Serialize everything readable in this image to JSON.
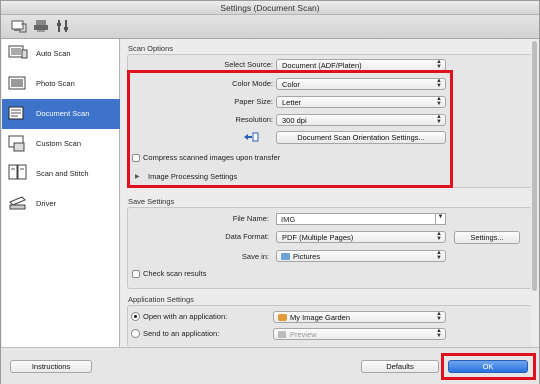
{
  "window": {
    "title": "Settings (Document Scan)"
  },
  "toolbar": {
    "icons": [
      "scan-from-computer-icon",
      "scan-from-panel-icon",
      "general-settings-icon"
    ]
  },
  "sidebar": {
    "items": [
      {
        "label": "Auto Scan",
        "icon": "auto-scan-icon",
        "active": false
      },
      {
        "label": "Photo Scan",
        "icon": "photo-scan-icon",
        "active": false
      },
      {
        "label": "Document Scan",
        "icon": "document-scan-icon",
        "active": true
      },
      {
        "label": "Custom Scan",
        "icon": "custom-scan-icon",
        "active": false
      },
      {
        "label": "Scan and Stitch",
        "icon": "scan-and-stitch-icon",
        "active": false
      },
      {
        "label": "Driver",
        "icon": "driver-icon",
        "active": false
      }
    ]
  },
  "scan_options": {
    "title": "Scan Options",
    "select_source_label": "Select Source:",
    "select_source_value": "Document (ADF/Platen)",
    "color_mode_label": "Color Mode:",
    "color_mode_value": "Color",
    "paper_size_label": "Paper Size:",
    "paper_size_value": "Letter",
    "resolution_label": "Resolution:",
    "resolution_value": "300 dpi",
    "orientation_button": "Document Scan Orientation Settings...",
    "compress_label": "Compress scanned images upon transfer",
    "image_processing_label": "Image Processing Settings"
  },
  "save_settings": {
    "title": "Save Settings",
    "file_name_label": "File Name:",
    "file_name_value": "IMG",
    "data_format_label": "Data Format:",
    "data_format_value": "PDF (Multiple Pages)",
    "settings_button": "Settings...",
    "save_in_label": "Save in:",
    "save_in_value": "Pictures",
    "check_results_label": "Check scan results"
  },
  "application_settings": {
    "title": "Application Settings",
    "open_with_label": "Open with an application:",
    "open_with_value": "My Image Garden",
    "send_to_label": "Send to an application:",
    "send_to_value": "Preview"
  },
  "bottom": {
    "instructions_button": "Instructions",
    "defaults_button": "Defaults",
    "ok_button": "OK"
  },
  "colors": {
    "highlight": "#e01020",
    "sidebar_active": "#3d74c9"
  }
}
